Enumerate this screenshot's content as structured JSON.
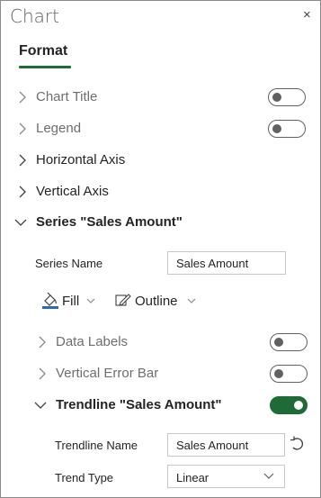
{
  "pane": {
    "title": "Chart",
    "close_label": "×"
  },
  "tabs": [
    {
      "label": "Format"
    }
  ],
  "sections": {
    "chart_title": "Chart Title",
    "legend": "Legend",
    "horizontal_axis": "Horizontal Axis",
    "vertical_axis": "Vertical Axis",
    "series": "Series \"Sales Amount\""
  },
  "series": {
    "name_label": "Series Name",
    "name_value": "Sales Amount",
    "fill_label": "Fill",
    "outline_label": "Outline",
    "data_labels": "Data Labels",
    "error_bar": "Vertical Error Bar",
    "trendline": "Trendline \"Sales Amount\"",
    "trendline_name_label": "Trendline Name",
    "trendline_name_value": "Sales Amount",
    "trend_type_label": "Trend Type",
    "trend_type_value": "Linear"
  },
  "toggles": {
    "chart_title": false,
    "legend": false,
    "data_labels": false,
    "error_bar": false,
    "trendline": true
  },
  "colors": {
    "accent": "#1e6b38",
    "fill_icon": "#2b6cb0",
    "muted_text": "#6e6e6e"
  },
  "icons": {
    "expand": "chevron-right-icon",
    "collapse": "chevron-down-icon",
    "fill": "paint-bucket-icon",
    "outline": "pencil-icon",
    "reset": "undo-icon",
    "close": "close-icon"
  }
}
